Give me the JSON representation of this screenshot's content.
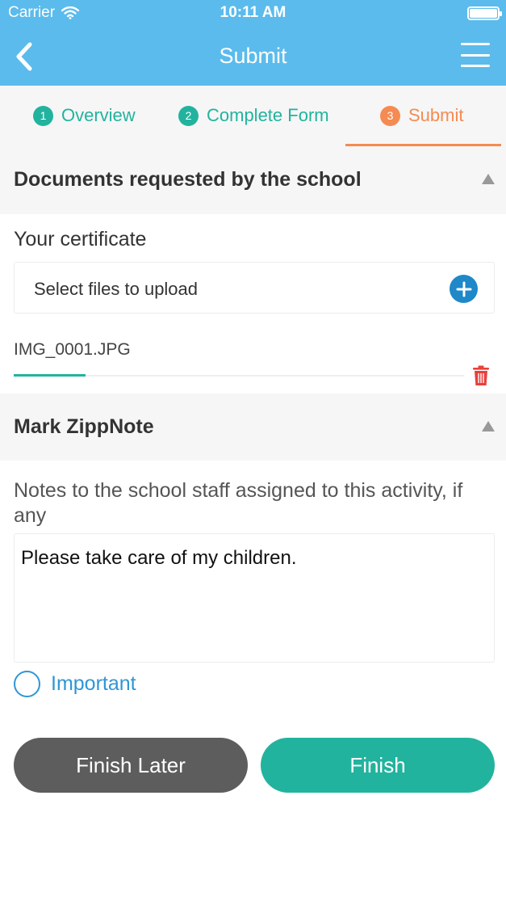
{
  "status_bar": {
    "carrier": "Carrier",
    "time": "10:11 AM"
  },
  "nav": {
    "title": "Submit",
    "back_icon": "chevron-left-icon",
    "menu_icon": "hamburger-menu-icon"
  },
  "steps": [
    {
      "number": "1",
      "label": "Overview",
      "state": "done"
    },
    {
      "number": "2",
      "label": "Complete Form",
      "state": "done"
    },
    {
      "number": "3",
      "label": "Submit",
      "state": "active"
    }
  ],
  "documents_section": {
    "title": "Documents requested by the school",
    "field_label": "Your certificate",
    "upload_placeholder": "Select files to upload",
    "file": {
      "name": "IMG_0001.JPG",
      "upload_progress": 0.16
    }
  },
  "zippnote_section": {
    "title": "Mark ZippNote",
    "notes_label": "Notes to the school staff assigned to this activity, if any",
    "notes_value": "Please take care of my children.",
    "important_label": "Important",
    "important_checked": false
  },
  "actions": {
    "finish_later": "Finish Later",
    "finish": "Finish"
  },
  "colors": {
    "header": "#5bbbec",
    "teal": "#22b39e",
    "orange": "#f58b52",
    "gray_button": "#5d5d5d",
    "delete_red": "#e8403a",
    "link_blue": "#2f96d6"
  }
}
